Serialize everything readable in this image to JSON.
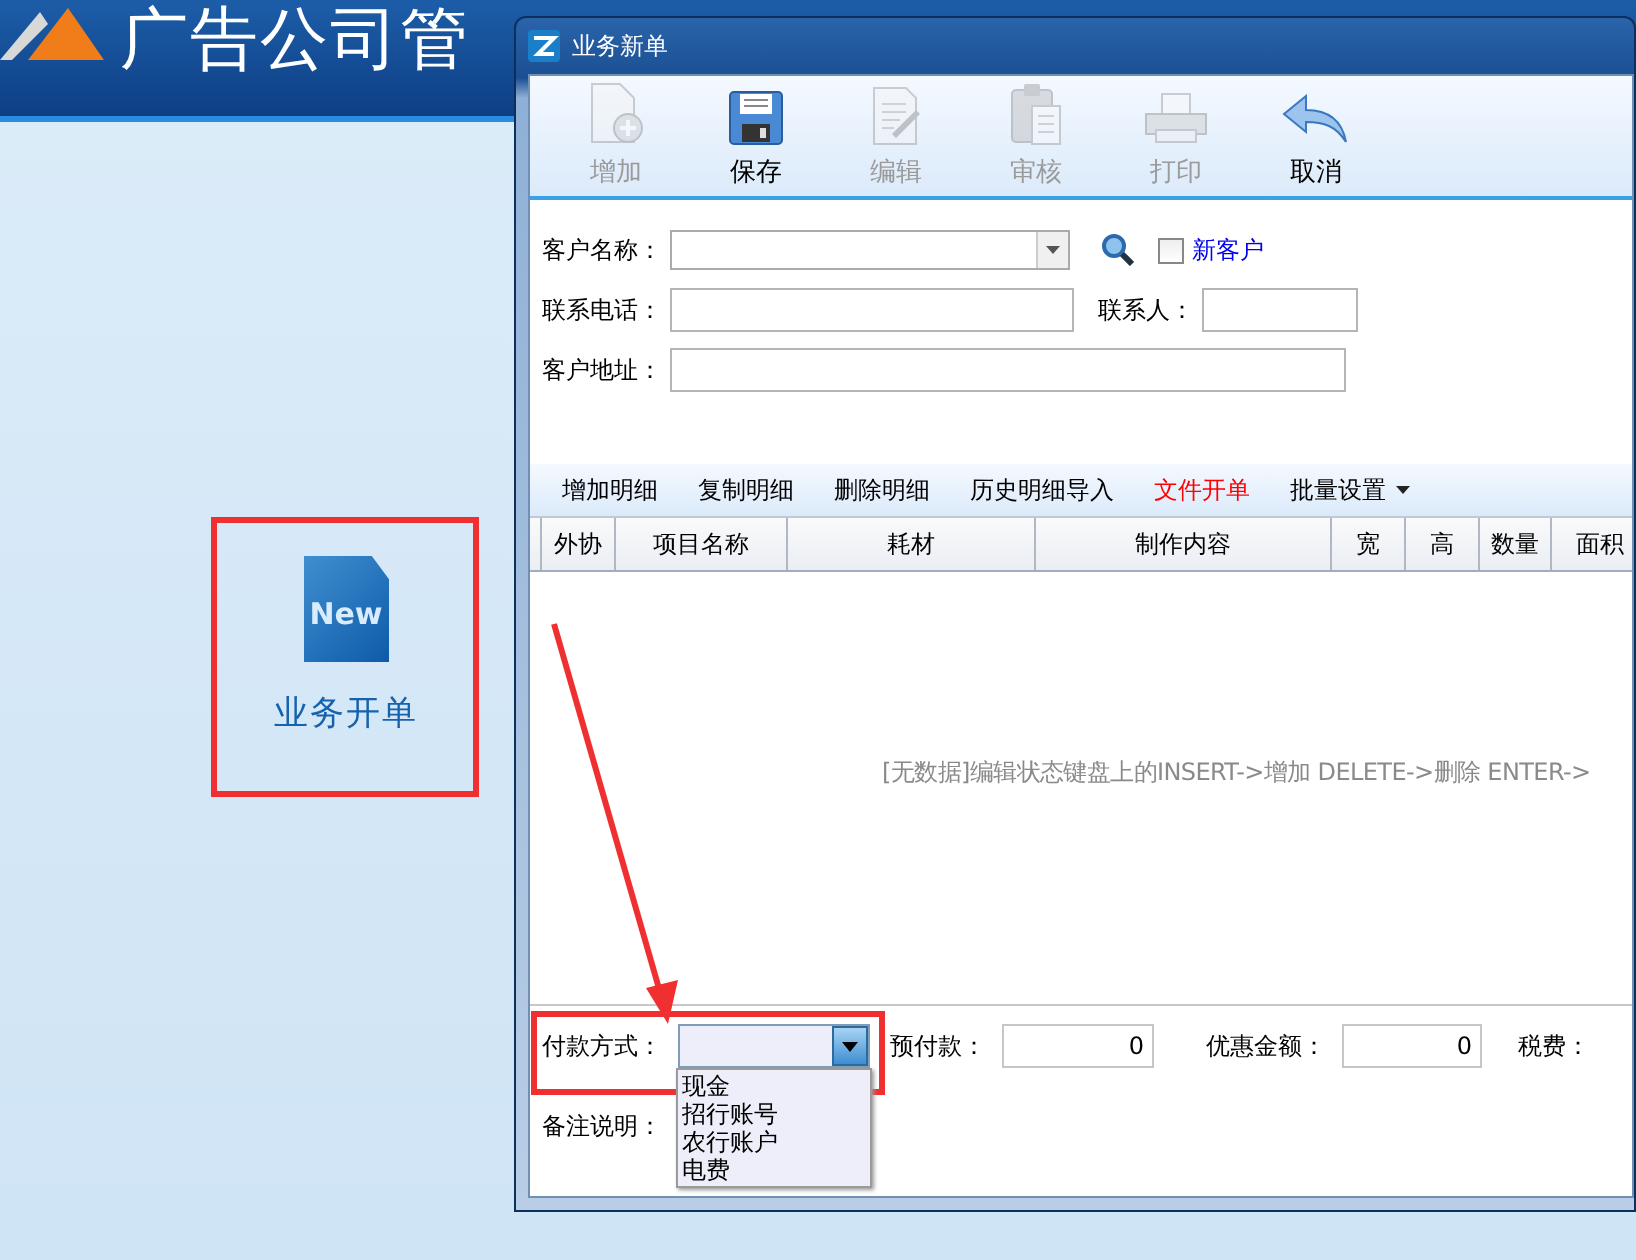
{
  "app": {
    "title": "广告公司管"
  },
  "launcher": {
    "icon_text": "New",
    "label": "业务开单"
  },
  "dialog": {
    "title": "业务新单",
    "toolbar": [
      {
        "label": "增加",
        "kind": "add",
        "enabled": false
      },
      {
        "label": "保存",
        "kind": "save",
        "enabled": true
      },
      {
        "label": "编辑",
        "kind": "edit",
        "enabled": false
      },
      {
        "label": "审核",
        "kind": "review",
        "enabled": false
      },
      {
        "label": "打印",
        "kind": "print",
        "enabled": false
      },
      {
        "label": "取消",
        "kind": "cancel",
        "enabled": true
      }
    ],
    "customer": {
      "name_label": "客户名称：",
      "new_customer": {
        "label": "新客户",
        "checked": false
      },
      "phone_label": "联系电话：",
      "contact_label": "联系人：",
      "address_label": "客户地址："
    },
    "detail_actions": [
      {
        "label": "增加明细",
        "kind": "plain"
      },
      {
        "label": "复制明细",
        "kind": "plain"
      },
      {
        "label": "删除明细",
        "kind": "plain"
      },
      {
        "label": "历史明细导入",
        "kind": "plain"
      },
      {
        "label": "文件开单",
        "kind": "highlight"
      },
      {
        "label": "批量设置",
        "kind": "menu"
      }
    ],
    "table": {
      "columns": [
        "外协",
        "项目名称",
        "耗材",
        "制作内容",
        "宽",
        "高",
        "数量",
        "面积"
      ],
      "empty_message": "[无数据]编辑状态键盘上的INSERT->增加 DELETE->删除 ENTER->"
    },
    "payment": {
      "label": "付款方式：",
      "expanded": true,
      "options": [
        "现金",
        "招行账号",
        "农行账户",
        "电费"
      ]
    },
    "prepaid": {
      "label": "预付款：",
      "value": "0"
    },
    "discount": {
      "label": "优惠金额：",
      "value": "0"
    },
    "tax": {
      "label": "税费："
    },
    "remark": {
      "label": "备注说明："
    }
  }
}
